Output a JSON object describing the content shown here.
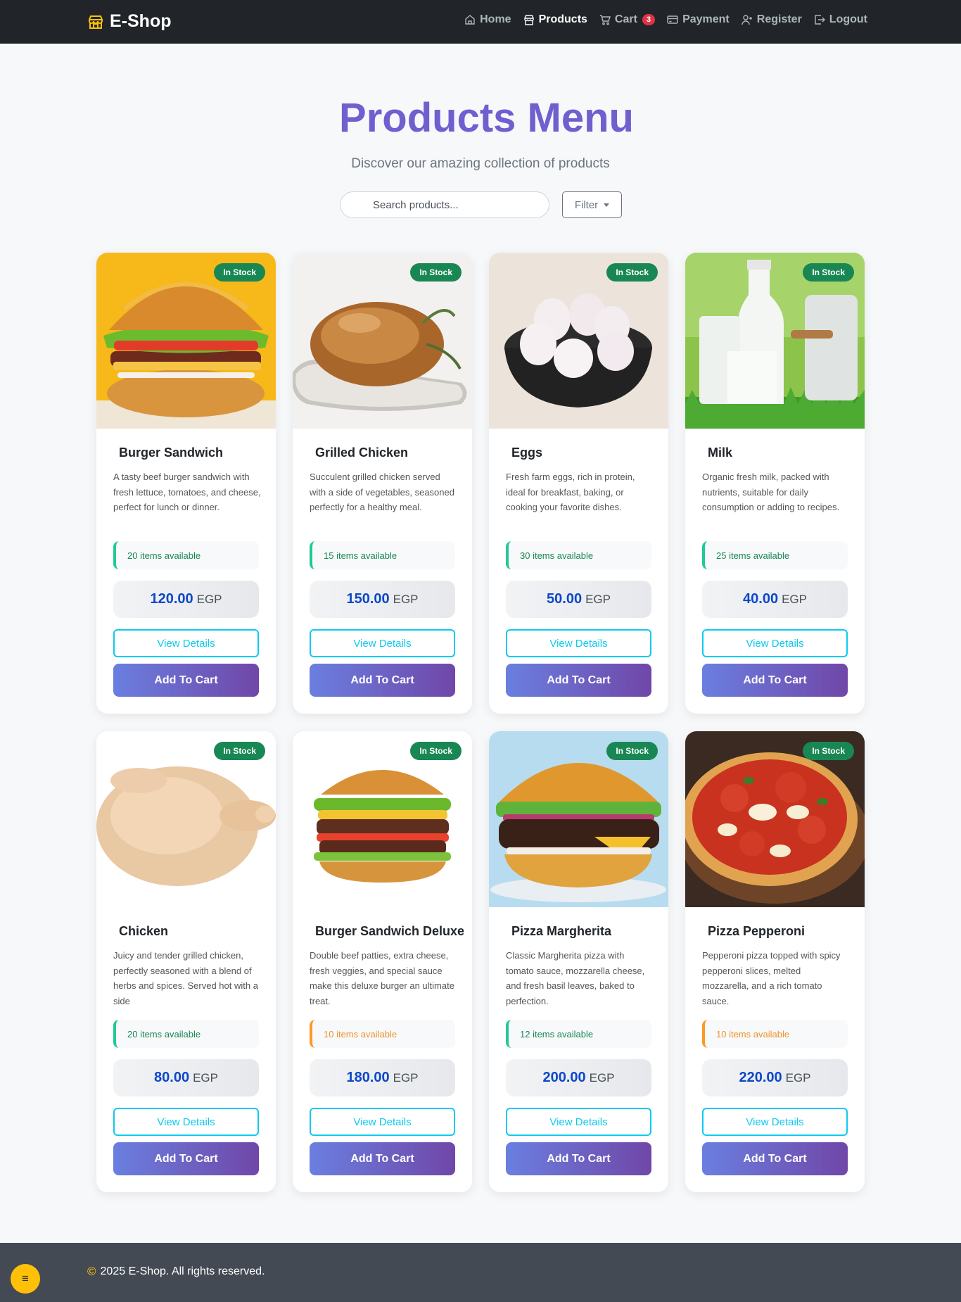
{
  "nav": {
    "brand": "E-Shop",
    "links": [
      {
        "label": "Home",
        "icon": "home-icon"
      },
      {
        "label": "Products",
        "icon": "store-icon"
      },
      {
        "label": "Cart",
        "icon": "cart-icon"
      },
      {
        "label": "Payment",
        "icon": "credit-card-icon"
      },
      {
        "label": "Register",
        "icon": "person-plus-icon"
      },
      {
        "label": "Logout",
        "icon": "logout-icon"
      }
    ],
    "cart_count": "3"
  },
  "hero": {
    "title": "Products Menu",
    "subtitle": "Discover our amazing collection of products"
  },
  "search": {
    "placeholder": "Search products..."
  },
  "filter": {
    "label": "Filter"
  },
  "products": [
    {
      "name": "Burger Sandwich",
      "badge": "In Stock",
      "description": "A tasty beef burger sandwich with fresh lettuce, tomatoes, and cheese, perfect for lunch or dinner.",
      "stock": "20 items available",
      "stock_low": false,
      "price": "120.00",
      "currency": "EGP",
      "view_label": "View Details",
      "cart_label": "Add To Cart"
    },
    {
      "name": "Grilled Chicken",
      "badge": "In Stock",
      "description": "Succulent grilled chicken served with a side of vegetables, seasoned perfectly for a healthy meal.",
      "stock": "15 items available",
      "stock_low": false,
      "price": "150.00",
      "currency": "EGP",
      "view_label": "View Details",
      "cart_label": "Add To Cart"
    },
    {
      "name": "Eggs",
      "badge": "In Stock",
      "description": "Fresh farm eggs, rich in protein, ideal for breakfast, baking, or cooking your favorite dishes.",
      "stock": "30 items available",
      "stock_low": false,
      "price": "50.00",
      "currency": "EGP",
      "view_label": "View Details",
      "cart_label": "Add To Cart"
    },
    {
      "name": "Milk",
      "badge": "In Stock",
      "description": "Organic fresh milk, packed with nutrients, suitable for daily consumption or adding to recipes.",
      "stock": "25 items available",
      "stock_low": false,
      "price": "40.00",
      "currency": "EGP",
      "view_label": "View Details",
      "cart_label": "Add To Cart"
    },
    {
      "name": "Chicken",
      "badge": "In Stock",
      "description": "Juicy and tender grilled chicken, perfectly seasoned with a blend of herbs and spices. Served hot with a side",
      "stock": "20 items available",
      "stock_low": false,
      "price": "80.00",
      "currency": "EGP",
      "view_label": "View Details",
      "cart_label": "Add To Cart"
    },
    {
      "name": "Burger Sandwich Deluxe",
      "badge": "In Stock",
      "description": "Double beef patties, extra cheese, fresh veggies, and special sauce make this deluxe burger an ultimate treat.",
      "stock": "10 items available",
      "stock_low": true,
      "price": "180.00",
      "currency": "EGP",
      "view_label": "View Details",
      "cart_label": "Add To Cart"
    },
    {
      "name": "Pizza Margherita",
      "badge": "In Stock",
      "description": "Classic Margherita pizza with tomato sauce, mozzarella cheese, and fresh basil leaves, baked to perfection.",
      "stock": "12 items available",
      "stock_low": false,
      "price": "200.00",
      "currency": "EGP",
      "view_label": "View Details",
      "cart_label": "Add To Cart"
    },
    {
      "name": "Pizza Pepperoni",
      "badge": "In Stock",
      "description": "Pepperoni pizza topped with spicy pepperoni slices, melted mozzarella, and a rich tomato sauce.",
      "stock": "10 items available",
      "stock_low": true,
      "price": "220.00",
      "currency": "EGP",
      "view_label": "View Details",
      "cart_label": "Add To Cart"
    }
  ],
  "footer": {
    "text": "2025 E-Shop. All rights reserved."
  },
  "colors": {
    "accent": "#6f5fcf",
    "stock_ok": "#20c997",
    "stock_low": "#fd9a26",
    "price": "#0d47c9",
    "cyan": "#0dcaf0",
    "nav_bg": "#212529",
    "footer_bg": "#444a54"
  }
}
